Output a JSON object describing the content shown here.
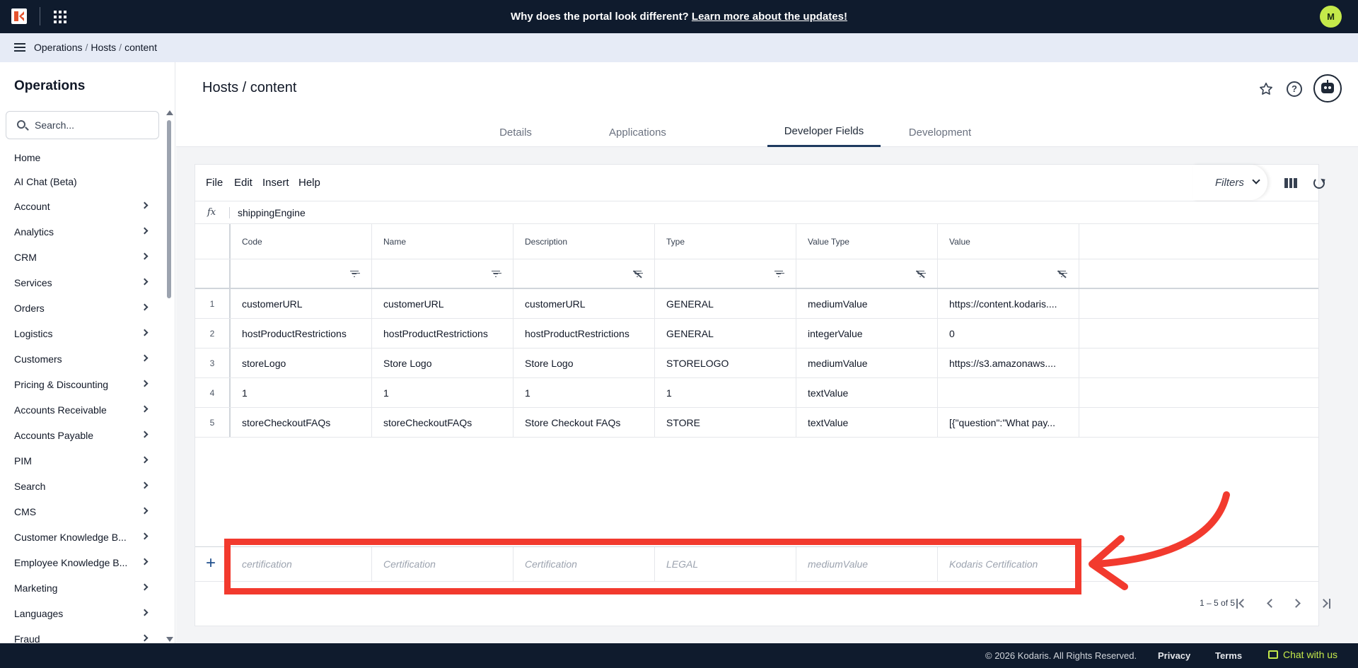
{
  "topbar": {
    "announcement": "Why does the portal look different?",
    "announcement_link": "Learn more about the updates!",
    "avatar_initial": "M"
  },
  "breadcrumb": [
    "Operations",
    "Hosts",
    "content"
  ],
  "sidebar": {
    "title": "Operations",
    "search_placeholder": "Search...",
    "items": [
      {
        "label": "Home",
        "chevron": false
      },
      {
        "label": "AI Chat (Beta)",
        "chevron": false
      },
      {
        "label": "Account",
        "chevron": true
      },
      {
        "label": "Analytics",
        "chevron": true
      },
      {
        "label": "CRM",
        "chevron": true
      },
      {
        "label": "Services",
        "chevron": true
      },
      {
        "label": "Orders",
        "chevron": true
      },
      {
        "label": "Logistics",
        "chevron": true
      },
      {
        "label": "Customers",
        "chevron": true
      },
      {
        "label": "Pricing & Discounting",
        "chevron": true
      },
      {
        "label": "Accounts Receivable",
        "chevron": true
      },
      {
        "label": "Accounts Payable",
        "chevron": true
      },
      {
        "label": "PIM",
        "chevron": true
      },
      {
        "label": "Search",
        "chevron": true
      },
      {
        "label": "CMS",
        "chevron": true
      },
      {
        "label": "Customer Knowledge B...",
        "chevron": true
      },
      {
        "label": "Employee Knowledge B...",
        "chevron": true
      },
      {
        "label": "Marketing",
        "chevron": true
      },
      {
        "label": "Languages",
        "chevron": true
      },
      {
        "label": "Fraud",
        "chevron": true
      }
    ]
  },
  "page": {
    "title": "Hosts / content",
    "tabs": [
      "Details",
      "Applications",
      "Developer Fields",
      "Development"
    ],
    "active_tab": "Developer Fields"
  },
  "grid": {
    "menu": [
      "File",
      "Edit",
      "Insert",
      "Help"
    ],
    "filters_label": "Filters",
    "fx_label": "fx",
    "formula_value": "shippingEngine",
    "columns": [
      "Code",
      "Name",
      "Description",
      "Type",
      "Value Type",
      "Value"
    ],
    "column_filter_active": [
      true,
      true,
      false,
      true,
      false,
      false
    ],
    "rows": [
      {
        "index": "1",
        "cells": [
          "customerURL",
          "customerURL",
          "customerURL",
          "GENERAL",
          "mediumValue",
          "https://content.kodaris...."
        ]
      },
      {
        "index": "2",
        "cells": [
          "hostProductRestrictions",
          "hostProductRestrictions",
          "hostProductRestrictions",
          "GENERAL",
          "integerValue",
          "0"
        ]
      },
      {
        "index": "3",
        "cells": [
          "storeLogo",
          "Store Logo",
          "Store Logo",
          "STORELOGO",
          "mediumValue",
          "https://s3.amazonaws...."
        ]
      },
      {
        "index": "4",
        "cells": [
          "1",
          "1",
          "1",
          "1",
          "textValue",
          ""
        ]
      },
      {
        "index": "5",
        "cells": [
          "storeCheckoutFAQs",
          "storeCheckoutFAQs",
          "Store Checkout FAQs",
          "STORE",
          "textValue",
          "[{\"question\":\"What pay..."
        ]
      }
    ],
    "new_row_placeholders": [
      "certification",
      "Certification",
      "Certification",
      "LEGAL",
      "mediumValue",
      "Kodaris Certification"
    ],
    "pagination": "1 – 5 of 5"
  },
  "footer": {
    "copyright": "© 2026 Kodaris. All Rights Reserved.",
    "privacy": "Privacy",
    "terms": "Terms",
    "chat": "Chat with us"
  },
  "colors": {
    "topbar": "#0f1b2d",
    "accent": "#c4e94a",
    "highlight": "#f23a2e"
  }
}
